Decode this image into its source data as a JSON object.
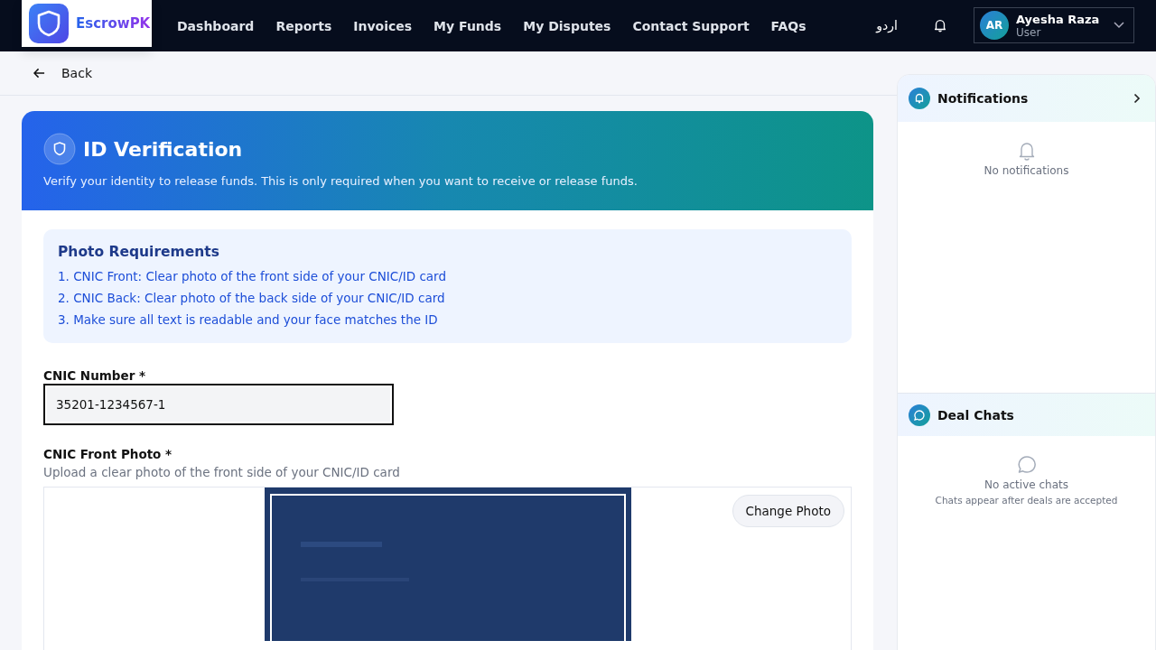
{
  "header": {
    "logo_text": "EscrowPK",
    "nav": [
      "Dashboard",
      "Reports",
      "Invoices",
      "My Funds",
      "My Disputes",
      "Contact Support",
      "FAQs"
    ],
    "language": "اردو",
    "user": {
      "initials": "AR",
      "name": "Ayesha Raza",
      "role": "User"
    }
  },
  "back": "Back",
  "verification": {
    "title": "ID Verification",
    "subtitle": "Verify your identity to release funds. This is only required when you want to receive or release funds.",
    "requirements": {
      "title": "Photo Requirements",
      "items": [
        "1. CNIC Front: Clear photo of the front side of your CNIC/ID card",
        "2. CNIC Back: Clear photo of the back side of your CNIC/ID card",
        "3. Make sure all text is readable and your face matches the ID"
      ]
    },
    "cnic": {
      "label": "CNIC Number *",
      "value": "35201-1234567-1"
    },
    "front_photo": {
      "label": "CNIC Front Photo *",
      "hint": "Upload a clear photo of the front side of your CNIC/ID card",
      "button": "Change Photo"
    }
  },
  "notifications": {
    "title": "Notifications",
    "empty_text": "No notifications"
  },
  "deal_chats": {
    "title": "Deal Chats",
    "empty_text": "No active chats",
    "empty_hint": "Chats appear after deals are accepted"
  }
}
